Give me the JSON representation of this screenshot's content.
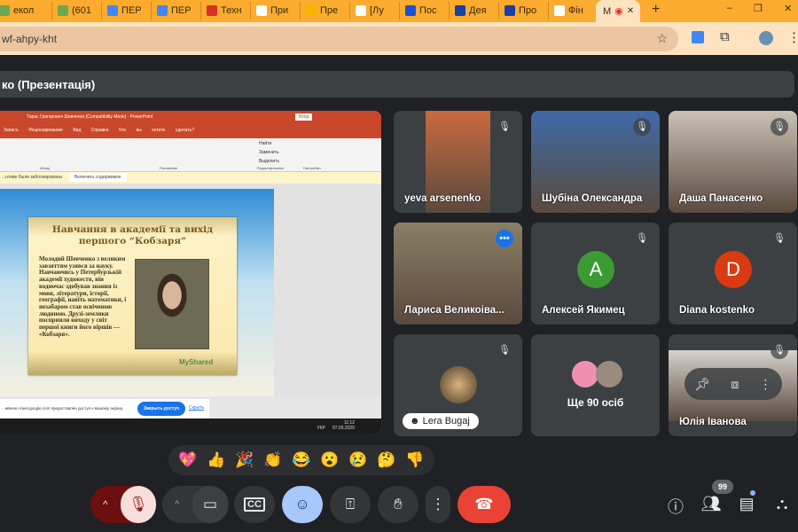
{
  "browser": {
    "tabs": [
      {
        "label": "екол",
        "icon": "tab-icon"
      },
      {
        "label": "(601",
        "icon": "mail-icon"
      },
      {
        "label": "ПЕР",
        "icon": "doc-icon"
      },
      {
        "label": "ПЕР",
        "icon": "doc-icon"
      },
      {
        "label": "Техн",
        "icon": "pdf-icon"
      },
      {
        "label": "При",
        "icon": "google-icon"
      },
      {
        "label": "Пре",
        "icon": "slides-icon"
      },
      {
        "label": "[Лу",
        "icon": "gmail-icon"
      },
      {
        "label": "Пос",
        "icon": "outlook-icon"
      },
      {
        "label": "Дея",
        "icon": "trident-icon"
      },
      {
        "label": "Про",
        "icon": "trident-icon"
      },
      {
        "label": "Фін",
        "icon": "google-icon"
      }
    ],
    "active_tab": {
      "label": "M",
      "icon": "record-icon"
    },
    "new_tab": "+",
    "url": "wf-ahpy-kht",
    "window_controls": [
      "–",
      "❐",
      "✕"
    ]
  },
  "meet": {
    "presentation_title": "ко (Презентація)",
    "powerpoint": {
      "title": "Тарас Григорович Шевченко [Compatibility Mode]  -  PowerPoint",
      "login": "Вход",
      "menu": "Записъ Рецензирование Вид Справка Что вы хотите сделать?",
      "ribbon_groups": [
        "Абзац",
        "Рисование",
        "Редактирование",
        "Настройки"
      ],
      "ribbon_items": [
        "Найти",
        "Заменить",
        "Выделить"
      ],
      "warning": "...нтиве были заблокированы",
      "enable_content": "Включить содержимое",
      "slide_title": "Навчання в академії та вихід першого “Кобзаря”",
      "slide_body": "Молодий Шевченко з великим завзяттям узявся за науку. Навчаючись у Петербурзькій академії художеств, він водночас здобував знання із мови, літератури, історії, географії, навіть математики, і незабаром став освіченою людиною. Друзі-земляки посприяли виходу у світ першої книги його віршів — «Кобзаря».",
      "watermark": "MyShared",
      "share_notice": "...ивенно meet.google.com предоставлен доступ к вашему экрану.",
      "stop_sharing": "Закрыть доступ",
      "hide": "Скрыть",
      "clock": "11:12",
      "date": "07.05.2025",
      "lang": "УКР"
    },
    "tiles": [
      {
        "name": "yeva arsenenko",
        "muted": true,
        "video": "#c96a3e"
      },
      {
        "name": "Шубіна Олександра",
        "muted": true,
        "video": "#3f6aa8"
      },
      {
        "name": "Даша Панасенко",
        "muted": true,
        "video": "#c9c2b5"
      },
      {
        "name": "Лариса Великоіва...",
        "muted": false,
        "video": "#8a7e66",
        "active": true
      },
      {
        "name": "Алексей Якимец",
        "muted": true,
        "avatar": "A",
        "color": "#3c9a35"
      },
      {
        "name": "Diana kostenko",
        "muted": true,
        "avatar": "D",
        "color": "#d93a12"
      },
      {
        "name": "Lera Bugaj",
        "muted": true,
        "photo": true
      },
      {
        "name": "Ще 90 осіб",
        "muted": false,
        "more": true
      },
      {
        "name": "Юлія Іванова",
        "muted": true,
        "video": "#d6d2cc"
      }
    ],
    "reactions": [
      "💖",
      "👍",
      "🎉",
      "👏",
      "😂",
      "😮",
      "😢",
      "🤔",
      "👎"
    ],
    "participant_count": "99",
    "accent": "#8ab4f8",
    "end_call_color": "#ea4335"
  }
}
